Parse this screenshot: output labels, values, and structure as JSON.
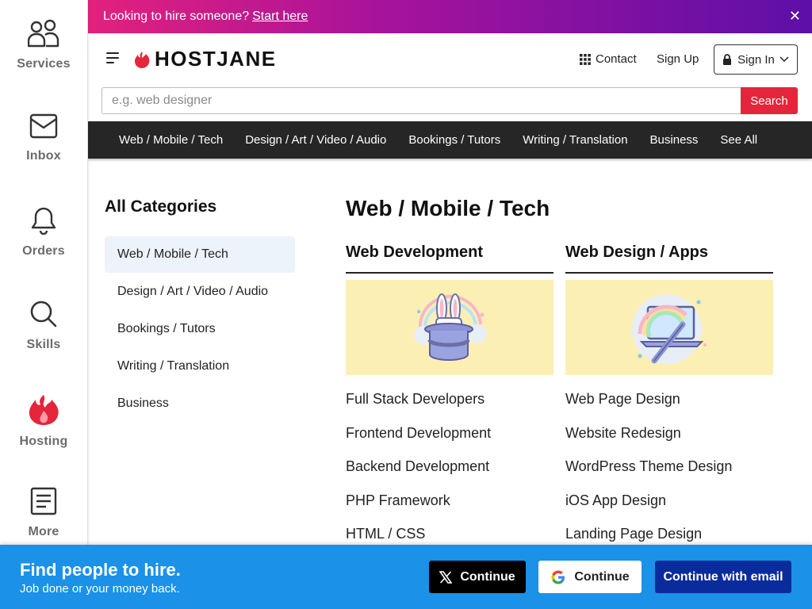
{
  "promo": {
    "text": "Looking to hire someone?",
    "link": "Start here",
    "close": "✕"
  },
  "rail": [
    {
      "label": "Services",
      "icon": "users-icon"
    },
    {
      "label": "Inbox",
      "icon": "mail-icon"
    },
    {
      "label": "Orders",
      "icon": "bell-icon"
    },
    {
      "label": "Skills",
      "icon": "search-icon"
    },
    {
      "label": "Hosting",
      "icon": "flame-icon"
    },
    {
      "label": "More",
      "icon": "document-icon"
    }
  ],
  "header": {
    "logo": "HOSTJANE",
    "contact": "Contact",
    "signup": "Sign Up",
    "signin": "Sign In"
  },
  "search": {
    "placeholder": "e.g. web designer",
    "button": "Search"
  },
  "catnav": [
    "Web / Mobile / Tech",
    "Design / Art / Video / Audio",
    "Bookings / Tutors",
    "Writing / Translation",
    "Business",
    "See All"
  ],
  "sidebar": {
    "title": "All Categories",
    "items": [
      "Web / Mobile / Tech",
      "Design / Art / Video / Audio",
      "Bookings / Tutors",
      "Writing / Translation",
      "Business"
    ]
  },
  "main": {
    "title": "Web / Mobile / Tech",
    "columns": [
      {
        "heading": "Web Development",
        "links": [
          "Full Stack Developers",
          "Frontend Development",
          "Backend Development",
          "PHP Framework",
          "HTML / CSS"
        ]
      },
      {
        "heading": "Web Design / Apps",
        "links": [
          "Web Page Design",
          "Website Redesign",
          "WordPress Theme Design",
          "iOS App Design",
          "Landing Page Design"
        ]
      }
    ]
  },
  "cta": {
    "heading": "Find people to hire.",
    "sub": "Job done or your money back.",
    "x_label": "Continue",
    "google_label": "Continue",
    "email_label": "Continue with email"
  },
  "colors": {
    "accent": "#e3263b",
    "cta_bg": "#1b91e8",
    "email_btn": "#0a2b9c",
    "nav_bg": "#262626"
  }
}
